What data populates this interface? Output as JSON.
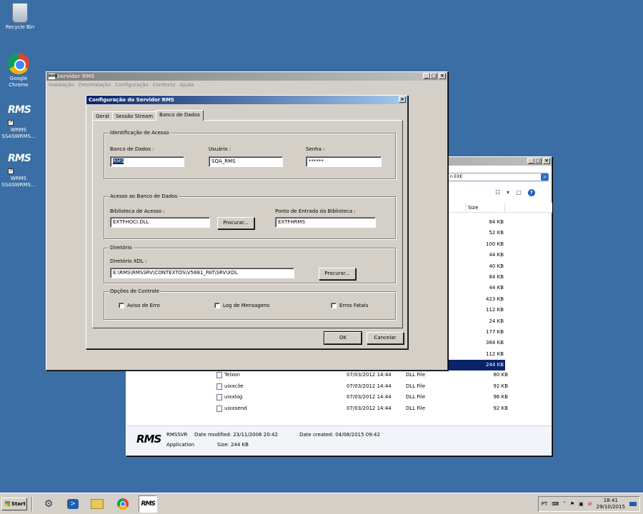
{
  "desktop": {
    "icons": [
      {
        "label": "Recycle Bin"
      },
      {
        "label": "Google Chrome"
      },
      {
        "label": "WRMS SSASWRMS..."
      },
      {
        "label": "WRMS SSASWRMS..."
      }
    ]
  },
  "explorer": {
    "address": "n EXE",
    "search_glyph": "⌕",
    "column_size": "Size",
    "sizes": [
      "84 KB",
      "52 KB",
      "100 KB",
      "44 KB",
      "40 KB",
      "84 KB",
      "44 KB",
      "423 KB",
      "112 KB",
      "24 KB",
      "177 KB",
      "384 KB",
      "112 KB",
      "244 KB"
    ],
    "selected_size_index": 13,
    "files": [
      {
        "name": "Telxon",
        "date": "07/03/2012 14:44",
        "type": "DLL File",
        "size": "80 KB"
      },
      {
        "name": "uixxclie",
        "date": "07/03/2012 14:44",
        "type": "DLL File",
        "size": "92 KB"
      },
      {
        "name": "uixxlog",
        "date": "07/03/2012 14:44",
        "type": "DLL File",
        "size": "96 KB"
      },
      {
        "name": "uixxsend",
        "date": "07/03/2012 14:44",
        "type": "DLL File",
        "size": "92 KB"
      }
    ],
    "details": {
      "logo": "RMS",
      "name": "RMSSVR",
      "modified": "Date modified: 23/11/2006 20:42",
      "created": "Date created: 04/08/2015 09:42",
      "kind": "Application",
      "size": "Size: 244 KB"
    }
  },
  "servidor": {
    "title": "Servidor RMS",
    "icon_text": "RMS",
    "menu": [
      "Instalação",
      "Desintalação",
      "Configuração",
      "Contexto",
      "Ajuda"
    ]
  },
  "config": {
    "title": "Configuração do Servidor RMS",
    "tabs": [
      "Geral",
      "Sessão Stream",
      "Banco de Dados"
    ],
    "active_tab": 2,
    "group_ident": {
      "legend": "Identificação de Acesso",
      "db_label": "Banco de Dados :",
      "db_value": "RMS",
      "user_label": "Usuário :",
      "user_value": "SQA_RMS",
      "pass_label": "Senha :",
      "pass_value": "******"
    },
    "group_access": {
      "legend": "Acesso ao Banco de Dados",
      "lib_label": "Biblioteca de Acesso :",
      "lib_value": "EXTFHOCI.DLL",
      "browse": "Procurar...",
      "entry_label": "Ponto de Entrada da Biblioteca :",
      "entry_value": "EXTFHRMS"
    },
    "group_dir": {
      "legend": "Diretório",
      "xdl_label": "Diretório XDL :",
      "xdl_value": "E:\\RMS\\RMSSRV\\CONTEXTOS\\V5681_PAT\\SRV\\XDL",
      "browse": "Procurar..."
    },
    "group_opts": {
      "legend": "Opções de Controle",
      "opt1": "Aviso de Erro",
      "opt2": "Log de Mensagens",
      "opt3": "Erros Fatais"
    },
    "ok": "OK",
    "cancel": "Cancelar"
  },
  "taskbar": {
    "start": "Start",
    "lang": "PT",
    "time": "18:41",
    "date": "29/10/2015"
  }
}
